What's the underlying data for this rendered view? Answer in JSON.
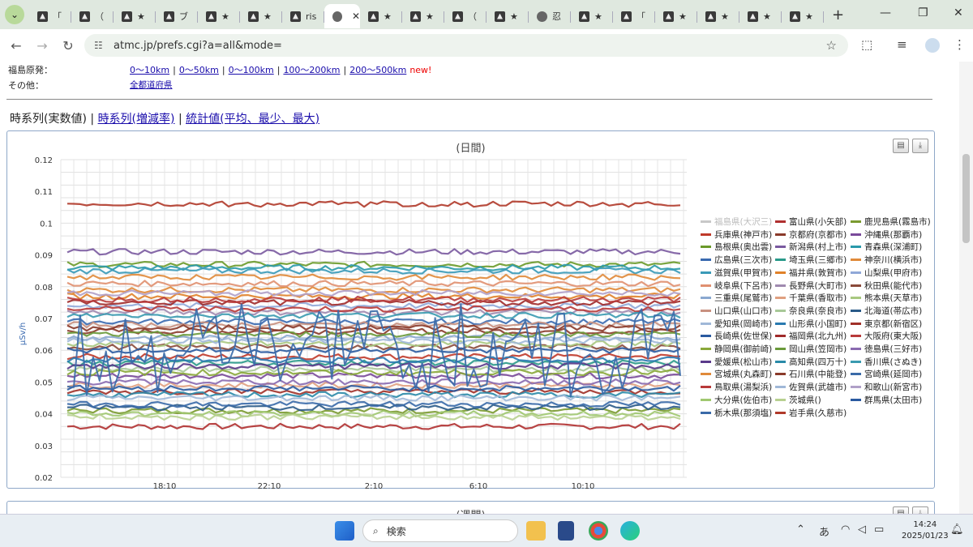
{
  "browser": {
    "tabs": [
      {
        "label": "「",
        "icon": "site-icon"
      },
      {
        "label": "（",
        "icon": "site-icon"
      },
      {
        "label": "★",
        "icon": "site-icon"
      },
      {
        "label": "ブ",
        "icon": "site-icon"
      },
      {
        "label": "★",
        "icon": "site-icon"
      },
      {
        "label": "★",
        "icon": "site-icon"
      },
      {
        "label": "ris",
        "icon": "site-icon"
      },
      {
        "label": "",
        "icon": "globe-icon",
        "active": true
      },
      {
        "label": "★",
        "icon": "site-icon"
      },
      {
        "label": "★",
        "icon": "site-icon"
      },
      {
        "label": "（",
        "icon": "site-icon"
      },
      {
        "label": "★",
        "icon": "site-icon"
      },
      {
        "label": "忍",
        "icon": "globe-icon"
      },
      {
        "label": "★",
        "icon": "site-icon"
      },
      {
        "label": "「",
        "icon": "site-icon"
      },
      {
        "label": "★",
        "icon": "site-icon"
      },
      {
        "label": "★",
        "icon": "site-icon"
      },
      {
        "label": "★",
        "icon": "site-icon"
      },
      {
        "label": "★",
        "icon": "site-icon"
      }
    ],
    "close_glyph": "✕",
    "newtab_glyph": "+",
    "url": "atmc.jp/prefs.cgi?a=all&mode="
  },
  "page": {
    "fukushima_label": "福島原発：",
    "fukushima_links": [
      "0～10km",
      "0～50km",
      "0～100km",
      "100～200km",
      "200～500km"
    ],
    "separator": "|",
    "new_label": "new!",
    "other_label": "その他：",
    "other_link": "全都道府県",
    "tab_current": "時系列(実数値)",
    "tab_links": [
      "時系列(増減率)",
      "統計値(平均、最少、最大)"
    ],
    "chart_title": "(日間)",
    "chart2_title": "(週間)"
  },
  "chart_data": {
    "type": "line",
    "title": "(日間)",
    "ylabel": "µSv/h",
    "ylim": [
      0.02,
      0.12
    ],
    "yticks": [
      "0.12",
      "0.11",
      "0.1",
      "0.09",
      "0.08",
      "0.07",
      "0.06",
      "0.05",
      "0.04",
      "0.03",
      "0.02"
    ],
    "xticks": [
      "18:10",
      "22:10",
      "2:10",
      "6:10",
      "10:10"
    ],
    "legend": [
      {
        "name": "福島県(大沢三)",
        "color": "#c8c8c8",
        "level": null
      },
      {
        "name": "富山県(小矢部)",
        "color": "#b03030",
        "level": 0.036
      },
      {
        "name": "鹿児島県(霧島市)",
        "color": "#7a9a30",
        "level": 0.041
      },
      {
        "name": "兵庫県(神戸市)",
        "color": "#c03a2a",
        "level": 0.058
      },
      {
        "name": "京都府(京都市)",
        "color": "#8a3a2a",
        "level": 0.066
      },
      {
        "name": "沖縄県(那覇市)",
        "color": "#7a4a9a",
        "level": 0.052
      },
      {
        "name": "島根県(奥出雲)",
        "color": "#6a9a2a",
        "level": 0.087
      },
      {
        "name": "新潟県(村上市)",
        "color": "#7a5aa0",
        "level": 0.091
      },
      {
        "name": "青森県(深浦町)",
        "color": "#2a9aaa",
        "level": 0.086
      },
      {
        "name": "広島県(三次市)",
        "color": "#3a6ab0",
        "level": 0.069
      },
      {
        "name": "埼玉県(三郷市)",
        "color": "#2a9a8a",
        "level": 0.056
      },
      {
        "name": "神奈川(横浜市)",
        "color": "#e08a3a",
        "level": 0.079
      },
      {
        "name": "滋賀県(甲賀市)",
        "color": "#3a9ab8",
        "level": 0.085
      },
      {
        "name": "福井県(敦賀市)",
        "color": "#e0822a",
        "level": 0.077
      },
      {
        "name": "山梨県(甲府市)",
        "color": "#90a8d8",
        "level": 0.074
      },
      {
        "name": "岐阜県(下呂市)",
        "color": "#e09070",
        "level": 0.081
      },
      {
        "name": "長野県(大町市)",
        "color": "#a08ab0",
        "level": 0.072
      },
      {
        "name": "秋田県(能代市)",
        "color": "#8a4a3a",
        "level": 0.061
      },
      {
        "name": "三重県(尾鷲市)",
        "color": "#8aa8d0",
        "level": 0.064
      },
      {
        "name": "千葉県(香取市)",
        "color": "#e0a080",
        "level": 0.049
      },
      {
        "name": "熊本県(天草市)",
        "color": "#a8c880",
        "level": 0.062
      },
      {
        "name": "山口県(山口市)",
        "color": "#c89080",
        "level": 0.068
      },
      {
        "name": "奈良県(奈良市)",
        "color": "#a8c898",
        "level": 0.054
      },
      {
        "name": "北海道(帯広市)",
        "color": "#2a5a88",
        "level": 0.042
      },
      {
        "name": "愛知県(岡崎市)",
        "color": "#a0b8d8",
        "level": 0.063
      },
      {
        "name": "山形県(小国町)",
        "color": "#2a7ab0",
        "level": 0.057
      },
      {
        "name": "東京都(新宿区)",
        "color": "#a03028",
        "level": 0.047
      },
      {
        "name": "長崎県(佐世保)",
        "color": "#2a5aa0",
        "level": 0.06
      },
      {
        "name": "福岡県(北九州)",
        "color": "#a02a2a",
        "level": 0.075
      },
      {
        "name": "大阪府(東大阪)",
        "color": "#b83a3a",
        "level": 0.073
      },
      {
        "name": "静岡県(御前崎)",
        "color": "#8aa83a",
        "level": 0.053
      },
      {
        "name": "岡山県(笠岡市)",
        "color": "#6a9a3a",
        "level": 0.065
      },
      {
        "name": "徳島県(三好市)",
        "color": "#8a6ab0",
        "level": 0.05
      },
      {
        "name": "愛媛県(松山市)",
        "color": "#5a3a8a",
        "level": 0.055
      },
      {
        "name": "高知県(四万十)",
        "color": "#2a8aa8",
        "level": 0.046
      },
      {
        "name": "香川県(さぬき)",
        "color": "#3a9ab0",
        "level": 0.071
      },
      {
        "name": "宮城県(丸森町)",
        "color": "#e08a3a",
        "level": 0.083
      },
      {
        "name": "石川県(中能登)",
        "color": "#8a3a2a",
        "level": 0.067
      },
      {
        "name": "宮崎県(延岡市)",
        "color": "#3a6aa8",
        "level": 0.043
      },
      {
        "name": "鳥取県(湯梨浜)",
        "color": "#b83a3a",
        "level": 0.076
      },
      {
        "name": "佐賀県(武雄市)",
        "color": "#a0b8d8",
        "level": 0.045
      },
      {
        "name": "和歌山(新宮市)",
        "color": "#b0a0c8",
        "level": 0.078
      },
      {
        "name": "大分県(佐伯市)",
        "color": "#a0c870",
        "level": 0.04
      },
      {
        "name": "茨城県()",
        "color": "#b8d090",
        "level": 0.039
      },
      {
        "name": "群馬県(太田市)",
        "color": "#2a5aa0",
        "level": 0.048
      },
      {
        "name": "栃木県(那須塩)",
        "color": "#3a6aa8",
        "level": 0.06,
        "volatile": true
      },
      {
        "name": "岩手県(久慈市)",
        "color": "#b03a2a",
        "level": 0.106
      }
    ]
  },
  "taskbar": {
    "search_placeholder": "検索",
    "ime": "あ",
    "time": "14:24",
    "date": "2025/01/23"
  }
}
